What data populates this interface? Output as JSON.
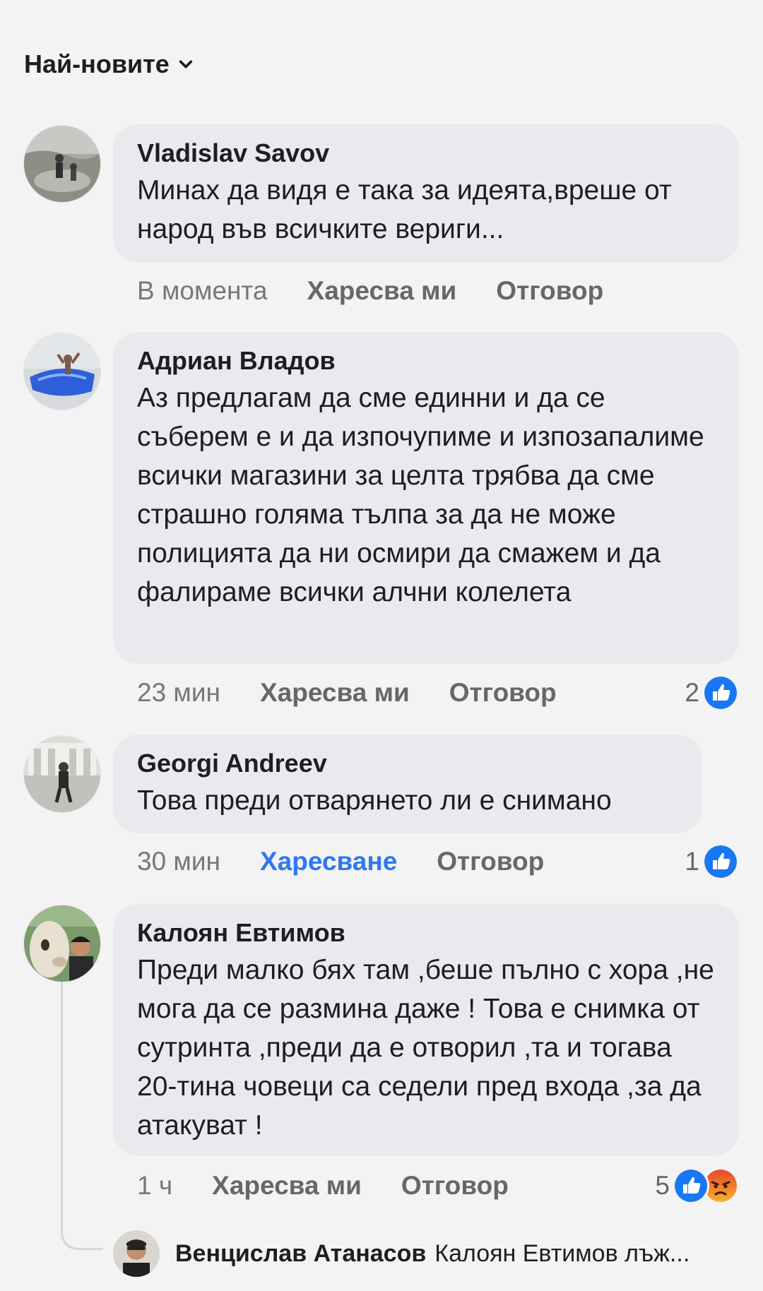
{
  "sort": {
    "label": "Най-новите"
  },
  "actions_labels": {
    "like": "Харесва ми",
    "reply": "Отговор"
  },
  "comments": [
    {
      "author": "Vladislav Savov",
      "text": "Минах да видя е така за идеята,вреше от народ във всичките вериги...",
      "time": "В момента",
      "like_label": "Харесва ми",
      "reply_label": "Отговор"
    },
    {
      "author": "Адриан Владов",
      "text": "Аз предлагам да сме единни и да се съберем е и да изпочупиме и изпозапалиме всички магазини за целта трябва да сме страшно голяма тълпа за да не може полицията да ни осмири да смажем и да фалираме всички алчни колелета",
      "time": "23 мин",
      "like_label": "Харесва ми",
      "reply_label": "Отговор",
      "reaction_count": "2"
    },
    {
      "author": "Georgi Andreev",
      "text": "Това преди отварянето ли е снимано",
      "time": "30 мин",
      "like_label": "Харесване",
      "reply_label": "Отговор",
      "reaction_count": "1"
    },
    {
      "author": "Калоян Евтимов",
      "text": "Преди малко бях там ,беше пълно с хора ,не мога да се размина даже ! Това е снимка от сутринта ,преди да е отворил ,та и тогава 20-тина човеци са седели пред входа ,за да атакуват !",
      "time": "1 ч",
      "like_label": "Харесва ми",
      "reply_label": "Отговор",
      "reaction_count": "5"
    }
  ],
  "reply_preview": {
    "author": "Венцислав Атанасов",
    "text": "Калоян Евтимов лъж..."
  },
  "colors": {
    "background": "#f3f3f3",
    "bubble": "#e9e9ee",
    "link_active": "#2e78f0",
    "like_blue": "#1877f2",
    "angry_orange": "#f0822f"
  },
  "icons": {
    "sort": "chevron-down-icon",
    "like": "like-reaction-icon",
    "angry": "angry-reaction-icon"
  }
}
